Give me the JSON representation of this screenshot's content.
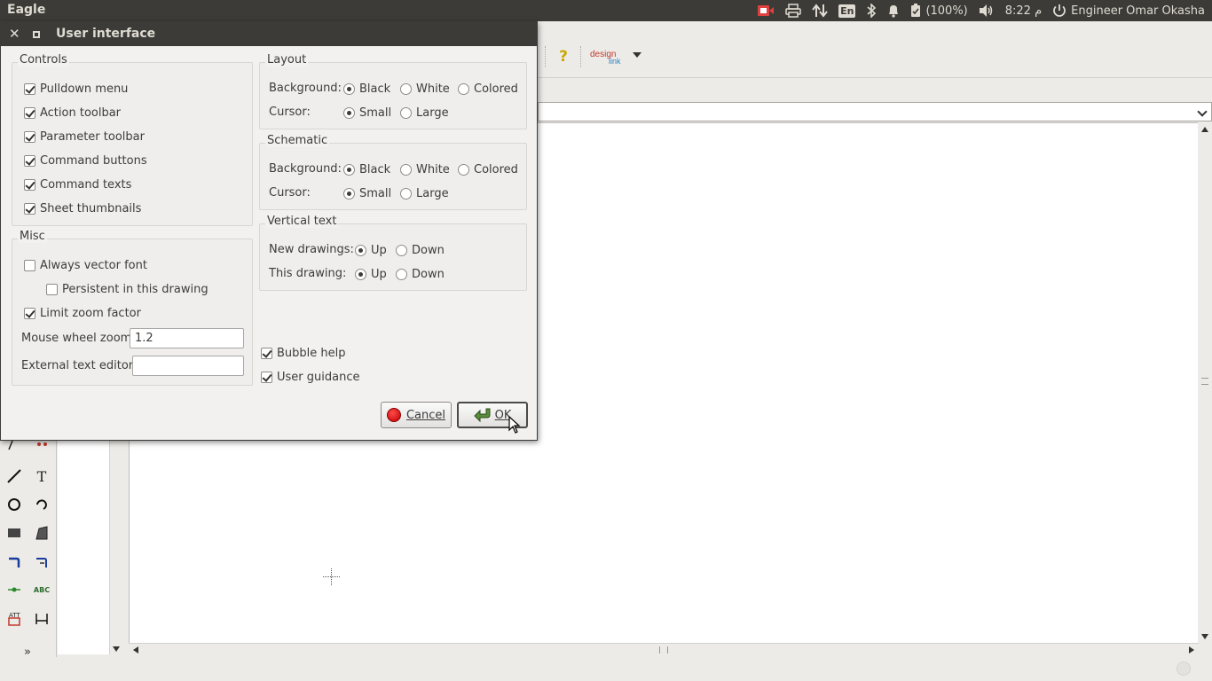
{
  "topbar": {
    "app_title": "Eagle",
    "language": "En",
    "battery": "(100%)",
    "clock": "8:22 م",
    "user": "Engineer Omar Okasha"
  },
  "dialog": {
    "title": "User interface",
    "controls": {
      "legend": "Controls",
      "items": [
        {
          "label": "Pulldown menu",
          "checked": true
        },
        {
          "label": "Action toolbar",
          "checked": true
        },
        {
          "label": "Parameter toolbar",
          "checked": true
        },
        {
          "label": "Command buttons",
          "checked": true
        },
        {
          "label": "Command texts",
          "checked": true
        },
        {
          "label": "Sheet thumbnails",
          "checked": true
        }
      ]
    },
    "misc": {
      "legend": "Misc",
      "always_vector_font": "Always vector font",
      "persistent": "Persistent in this drawing",
      "limit_zoom": "Limit zoom factor",
      "mouse_wheel_zoom_label": "Mouse wheel zoom",
      "mouse_wheel_zoom_value": "1.2",
      "external_editor_label": "External text editor",
      "external_editor_value": ""
    },
    "layout": {
      "legend": "Layout",
      "background_label": "Background:",
      "cursor_label": "Cursor:",
      "black": "Black",
      "white": "White",
      "colored": "Colored",
      "small": "Small",
      "large": "Large"
    },
    "schematic": {
      "legend": "Schematic",
      "background_label": "Background:",
      "cursor_label": "Cursor:",
      "black": "Black",
      "white": "White",
      "colored": "Colored",
      "small": "Small",
      "large": "Large"
    },
    "vertical_text": {
      "legend": "Vertical text",
      "new_drawings_label": "New drawings:",
      "this_drawing_label": "This drawing:",
      "up": "Up",
      "down": "Down"
    },
    "bubble_help": "Bubble help",
    "user_guidance": "User guidance",
    "cancel_button": "Cancel",
    "ok_button": "OK"
  },
  "toolbar": {
    "help": "?",
    "designlink": "design link"
  },
  "colors": {
    "titlebar": "#3c3b37",
    "dialog_bg": "#f2f1f0",
    "cancel_icon": "#d40000"
  }
}
